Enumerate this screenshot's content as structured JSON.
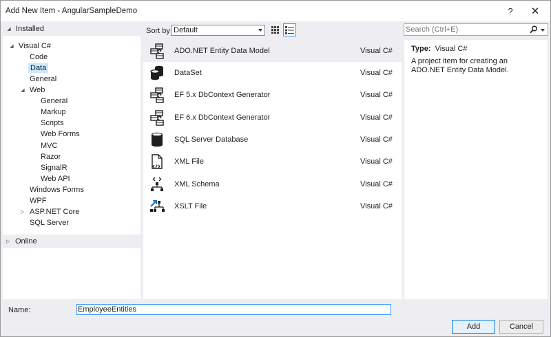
{
  "window": {
    "title": "Add New Item - AngularSampleDemo",
    "help_label": "?",
    "close_label": "✕"
  },
  "tree": {
    "installed": "Installed",
    "items": [
      {
        "label": "Visual C#",
        "expanded": true
      },
      {
        "label": "Code"
      },
      {
        "label": "Data",
        "selected": true
      },
      {
        "label": "General"
      },
      {
        "label": "Web",
        "expanded": true
      },
      {
        "label": "General"
      },
      {
        "label": "Markup"
      },
      {
        "label": "Scripts"
      },
      {
        "label": "Web Forms"
      },
      {
        "label": "MVC"
      },
      {
        "label": "Razor"
      },
      {
        "label": "SignalR"
      },
      {
        "label": "Web API"
      },
      {
        "label": "Windows Forms"
      },
      {
        "label": "WPF"
      },
      {
        "label": "ASP.NET Core",
        "expanded": false
      },
      {
        "label": "SQL Server"
      }
    ],
    "online": "Online"
  },
  "toolbar": {
    "sort_label": "Sort by:",
    "sort_value": "Default"
  },
  "search": {
    "placeholder": "Search (Ctrl+E)"
  },
  "templates": [
    {
      "name": "ADO.NET Entity Data Model",
      "lang": "Visual C#",
      "icon": "entity-model-icon",
      "selected": true
    },
    {
      "name": "DataSet",
      "lang": "Visual C#",
      "icon": "dataset-icon"
    },
    {
      "name": "EF 5.x DbContext Generator",
      "lang": "Visual C#",
      "icon": "entity-model-icon"
    },
    {
      "name": "EF 6.x DbContext Generator",
      "lang": "Visual C#",
      "icon": "entity-model-icon"
    },
    {
      "name": "SQL Server Database",
      "lang": "Visual C#",
      "icon": "database-icon"
    },
    {
      "name": "XML File",
      "lang": "Visual C#",
      "icon": "xml-file-icon"
    },
    {
      "name": "XML Schema",
      "lang": "Visual C#",
      "icon": "xml-schema-icon"
    },
    {
      "name": "XSLT File",
      "lang": "Visual C#",
      "icon": "xslt-file-icon"
    }
  ],
  "details": {
    "type_label": "Type:",
    "type_value": "Visual C#",
    "description": "A project item for creating an ADO.NET Entity Data Model."
  },
  "bottom": {
    "name_label": "Name:",
    "name_value": "EmployeeEntities",
    "add_label": "Add",
    "cancel_label": "Cancel"
  },
  "colors": {
    "selection": "#cce8ff",
    "accent": "#3399ff",
    "chrome": "#eeeef2"
  }
}
